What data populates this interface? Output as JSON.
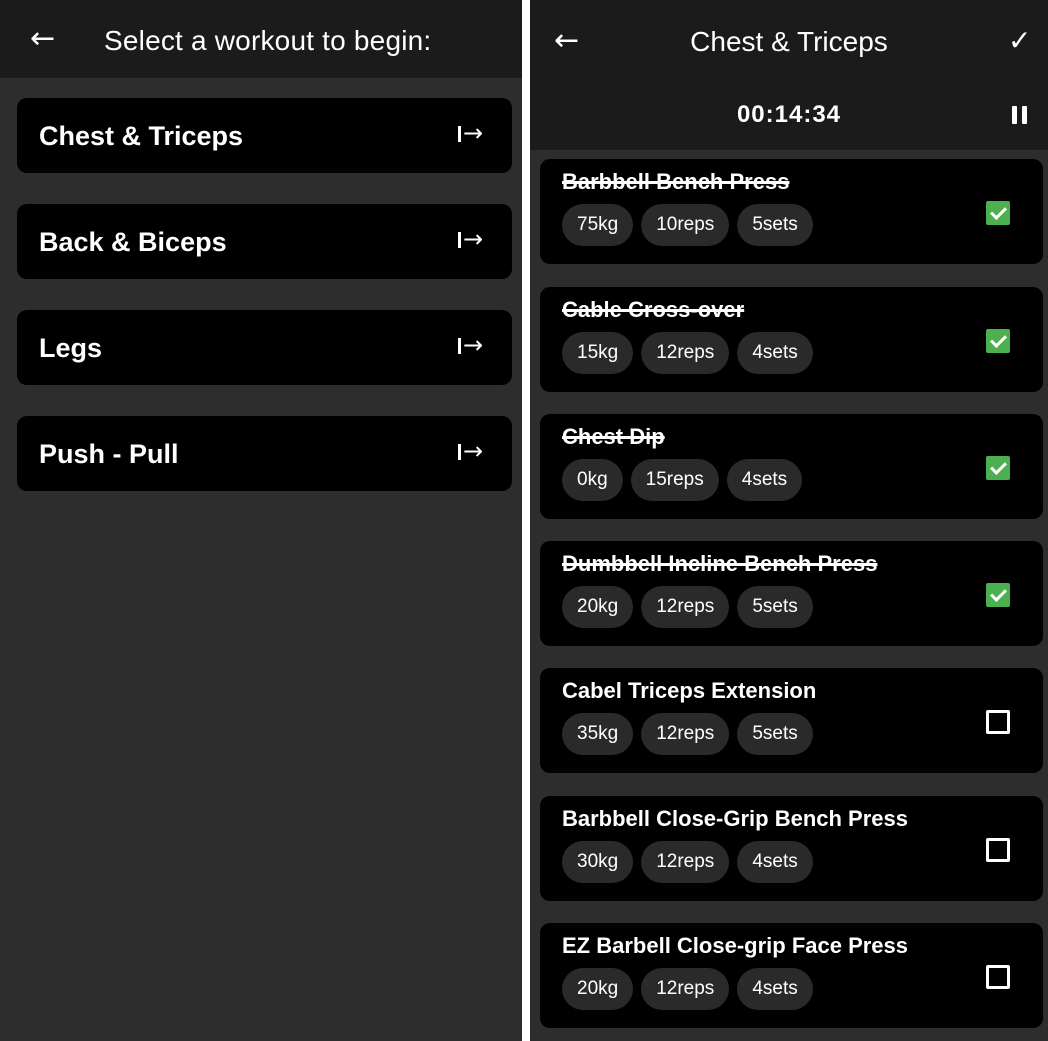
{
  "workout_select": {
    "back_icon": "arrow-left-icon",
    "title": "Select a workout to begin:",
    "go_icon": "arrow-right-from-bar-icon",
    "workouts": [
      {
        "name": "Chest & Triceps"
      },
      {
        "name": "Back & Biceps"
      },
      {
        "name": "Legs"
      },
      {
        "name": "Push - Pull"
      }
    ]
  },
  "active_workout": {
    "back_icon": "arrow-left-icon",
    "title": "Chest & Triceps",
    "confirm_icon": "checkmark-icon",
    "timer": "00:14:34",
    "pause_icon": "pause-icon",
    "exercises": [
      {
        "name": "Barbbell Bench Press",
        "weight": "75kg",
        "reps": "10reps",
        "sets": "5sets",
        "completed": true
      },
      {
        "name": "Cable Cross-over",
        "weight": "15kg",
        "reps": "12reps",
        "sets": "4sets",
        "completed": true
      },
      {
        "name": "Chest Dip",
        "weight": "0kg",
        "reps": "15reps",
        "sets": "4sets",
        "completed": true
      },
      {
        "name": "Dumbbell Incline Bench Press",
        "weight": "20kg",
        "reps": "12reps",
        "sets": "5sets",
        "completed": true
      },
      {
        "name": "Cabel Triceps Extension",
        "weight": "35kg",
        "reps": "12reps",
        "sets": "5sets",
        "completed": false
      },
      {
        "name": "Barbbell Close-Grip Bench Press",
        "weight": "30kg",
        "reps": "12reps",
        "sets": "4sets",
        "completed": false
      },
      {
        "name": "EZ Barbell Close-grip Face Press",
        "weight": "20kg",
        "reps": "12reps",
        "sets": "4sets",
        "completed": false
      }
    ]
  },
  "colors": {
    "background": "#2d2d2d",
    "header": "#1b1b1b",
    "card": "#000000",
    "chip": "#2a2a2a",
    "check_on": "#4caf50",
    "text": "#ffffff"
  }
}
